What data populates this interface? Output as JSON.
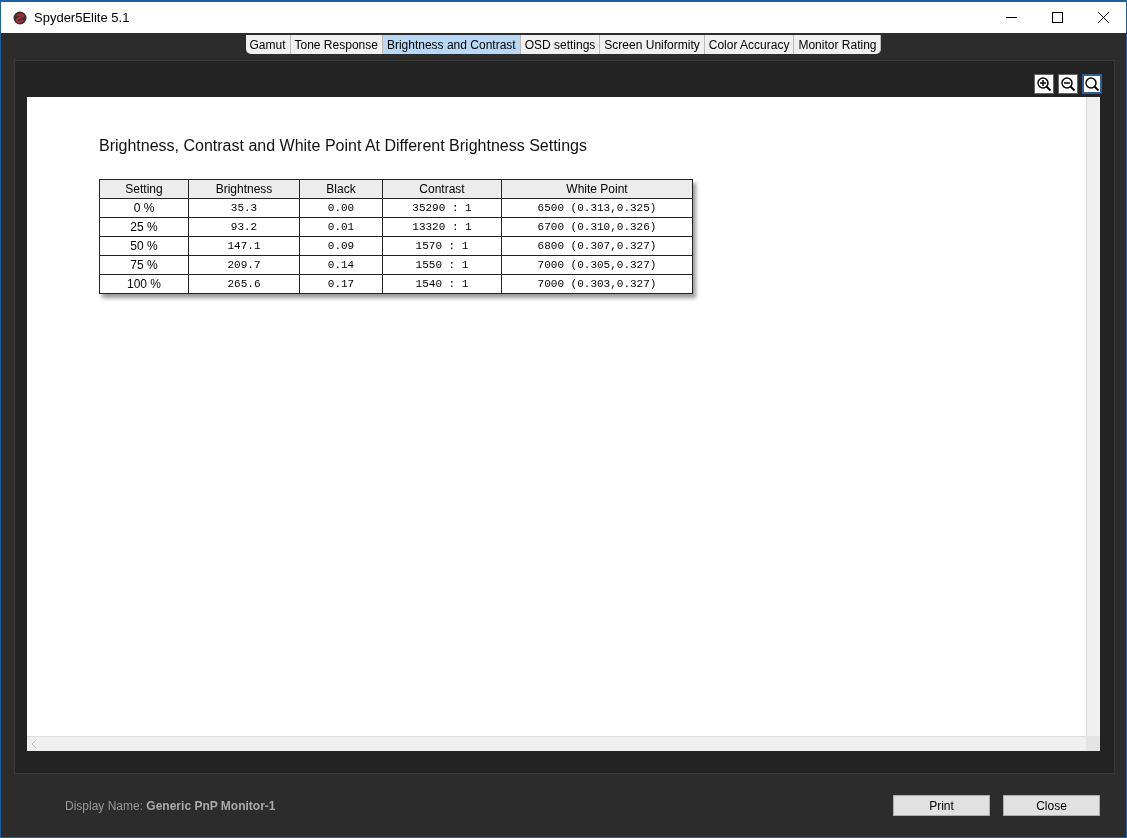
{
  "window": {
    "title": "Spyder5Elite 5.1"
  },
  "tabs": [
    {
      "label": "Gamut",
      "selected": false
    },
    {
      "label": "Tone Response",
      "selected": false
    },
    {
      "label": "Brightness and Contrast",
      "selected": true
    },
    {
      "label": "OSD settings",
      "selected": false
    },
    {
      "label": "Screen Uniformity",
      "selected": false
    },
    {
      "label": "Color Accuracy",
      "selected": false
    },
    {
      "label": "Monitor Rating",
      "selected": false
    }
  ],
  "zoom_tools": [
    {
      "kind": "zoom-in",
      "selected": false
    },
    {
      "kind": "zoom-out",
      "selected": false
    },
    {
      "kind": "zoom-fit",
      "selected": true
    }
  ],
  "report": {
    "heading": "Brightness, Contrast and White Point At Different Brightness Settings",
    "table": {
      "columns": [
        "Setting",
        "Brightness",
        "Black",
        "Contrast",
        "White Point"
      ],
      "rows": [
        [
          "0 %",
          "35.3",
          "0.00",
          "35290 : 1",
          "6500 (0.313,0.325)"
        ],
        [
          "25 %",
          "93.2",
          "0.01",
          "13320 : 1",
          "6700 (0.310,0.326)"
        ],
        [
          "50 %",
          "147.1",
          "0.09",
          "1570 : 1",
          "6800 (0.307,0.327)"
        ],
        [
          "75 %",
          "209.7",
          "0.14",
          "1550 : 1",
          "7000 (0.305,0.327)"
        ],
        [
          "100 %",
          "265.6",
          "0.17",
          "1540 : 1",
          "7000 (0.303,0.327)"
        ]
      ]
    }
  },
  "footer": {
    "display_name": "Display Name: **Generic PnP Monitor-1**",
    "buttons": [
      "Print",
      "Close"
    ]
  }
}
